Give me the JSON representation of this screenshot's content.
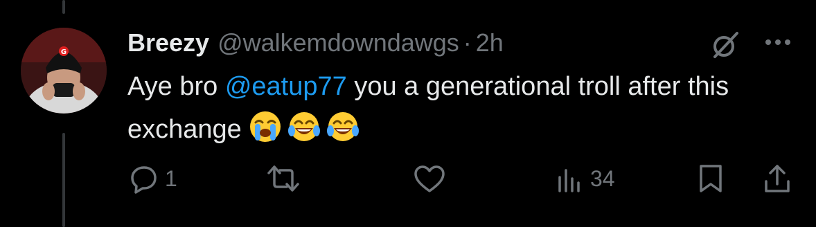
{
  "tweet": {
    "author": {
      "display_name": "Breezy",
      "handle": "@walkemdowndawgs"
    },
    "separator": "·",
    "timestamp": "2h",
    "text_before_mention": "Aye bro ",
    "mention": "@eatup77",
    "text_after_mention": " you a generational troll after this exchange ",
    "emojis": [
      "loudly-crying-face",
      "face-with-tears-of-joy",
      "face-with-tears-of-joy"
    ]
  },
  "actions": {
    "reply": {
      "icon": "reply-icon",
      "count": "1"
    },
    "retweet": {
      "icon": "retweet-icon",
      "count": ""
    },
    "like": {
      "icon": "heart-icon",
      "count": ""
    },
    "views": {
      "icon": "views-icon",
      "count": "34"
    },
    "bookmark": {
      "icon": "bookmark-icon"
    },
    "share": {
      "icon": "share-icon"
    }
  },
  "colors": {
    "background": "#000000",
    "text_primary": "#e7e9ea",
    "text_secondary": "#71767b",
    "accent": "#1d9bf0",
    "thread_line": "#333639"
  }
}
